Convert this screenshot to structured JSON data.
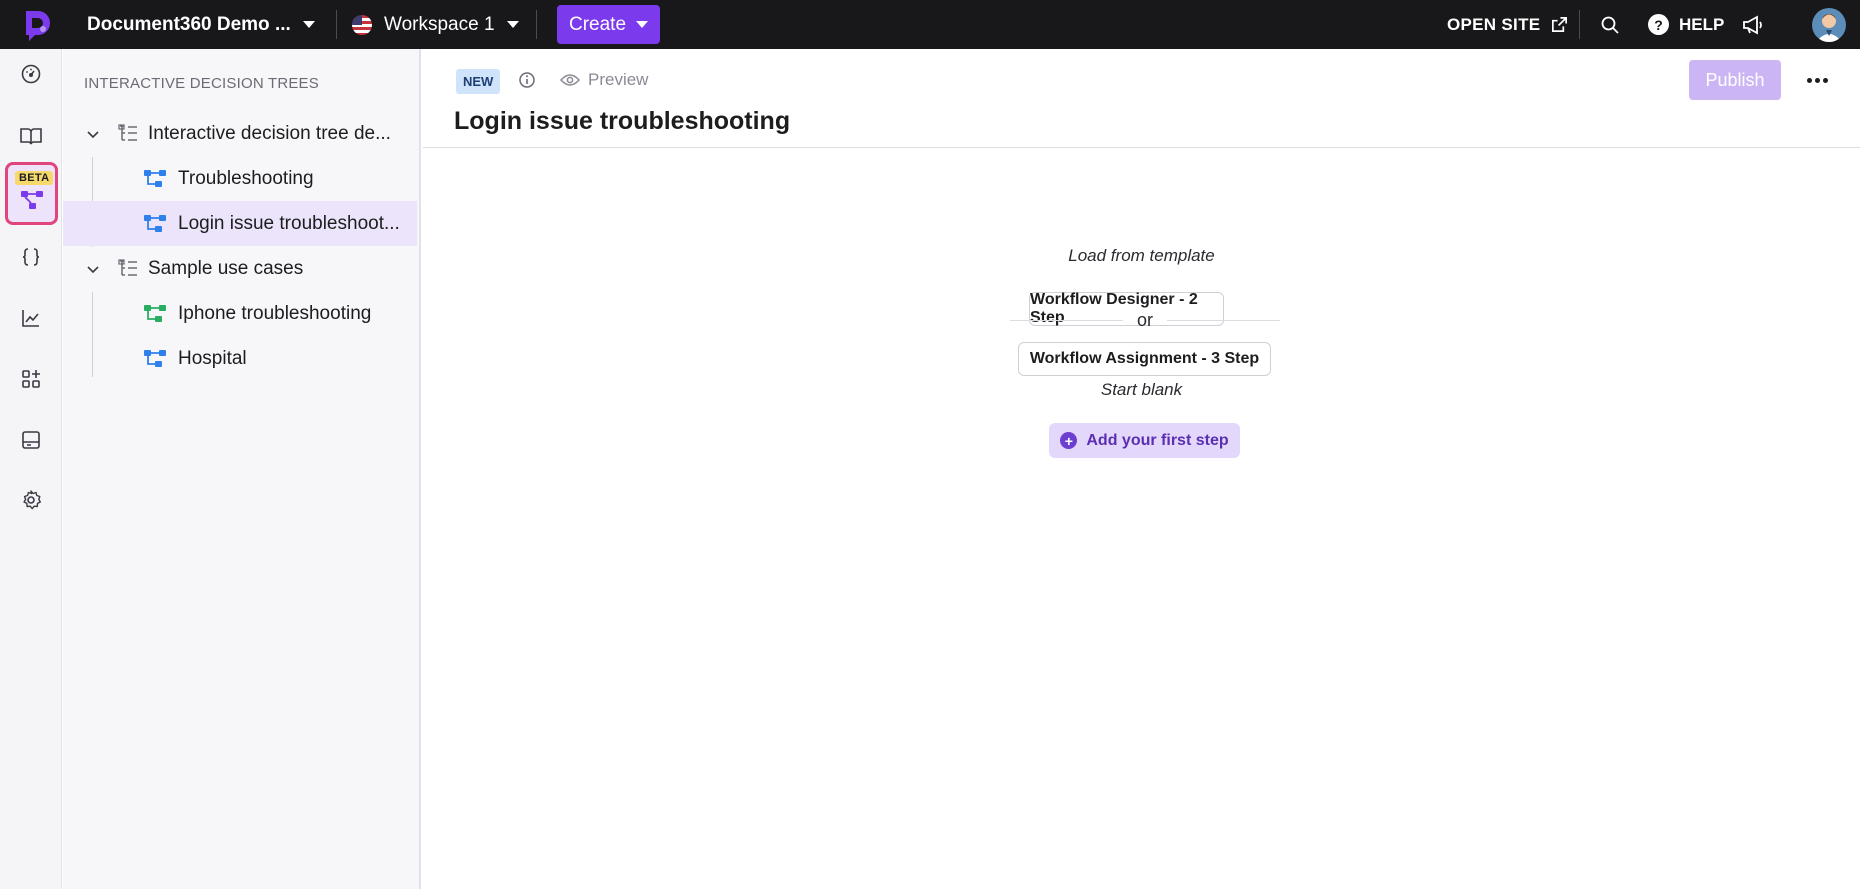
{
  "topbar": {
    "project_name": "Document360 Demo ...",
    "workspace_name": "Workspace 1",
    "create_label": "Create",
    "open_site_label": "OPEN SITE",
    "help_label": "HELP",
    "help_glyph": "?",
    "icons": [
      "document360-logo-icon",
      "chevron-down-icon",
      "us-flag-icon",
      "external-link-icon",
      "search-icon",
      "help-icon",
      "megaphone-icon",
      "avatar"
    ]
  },
  "rail": {
    "beta_label": "BETA",
    "icons": [
      "dashboard-icon",
      "book-icon",
      "decision-tree-icon",
      "api-braces-icon",
      "analytics-icon",
      "apps-icon",
      "widget-icon",
      "settings-icon"
    ],
    "accent_color": "#e0457b"
  },
  "tree": {
    "title": "INTERACTIVE DECISION TREES",
    "categories": [
      {
        "label": "Interactive decision tree de...",
        "items": [
          {
            "label": "Troubleshooting",
            "icon_color": "#2f80ed"
          },
          {
            "label": "Login issue troubleshoot...",
            "icon_color": "#2f80ed",
            "selected": true
          }
        ]
      },
      {
        "label": "Sample use cases",
        "items": [
          {
            "label": "Iphone troubleshooting",
            "icon_color": "#27ae60"
          },
          {
            "label": "Hospital",
            "icon_color": "#2f80ed"
          }
        ]
      }
    ]
  },
  "main": {
    "new_badge": "NEW",
    "preview_label": "Preview",
    "title": "Login issue troubleshooting",
    "publish_label": "Publish",
    "load_from_template_label": "Load from template",
    "templates": [
      "Workflow Designer - 2 Step",
      "Workflow Assignment - 3 Step"
    ],
    "or_label": "or",
    "start_blank_label": "Start blank",
    "add_step_label": "Add your first step",
    "add_step_glyph": "+"
  },
  "colors": {
    "brand_purple": "#7c3aed",
    "publish_disabled": "#cbb5f5",
    "selected_row": "#ece4fb"
  }
}
